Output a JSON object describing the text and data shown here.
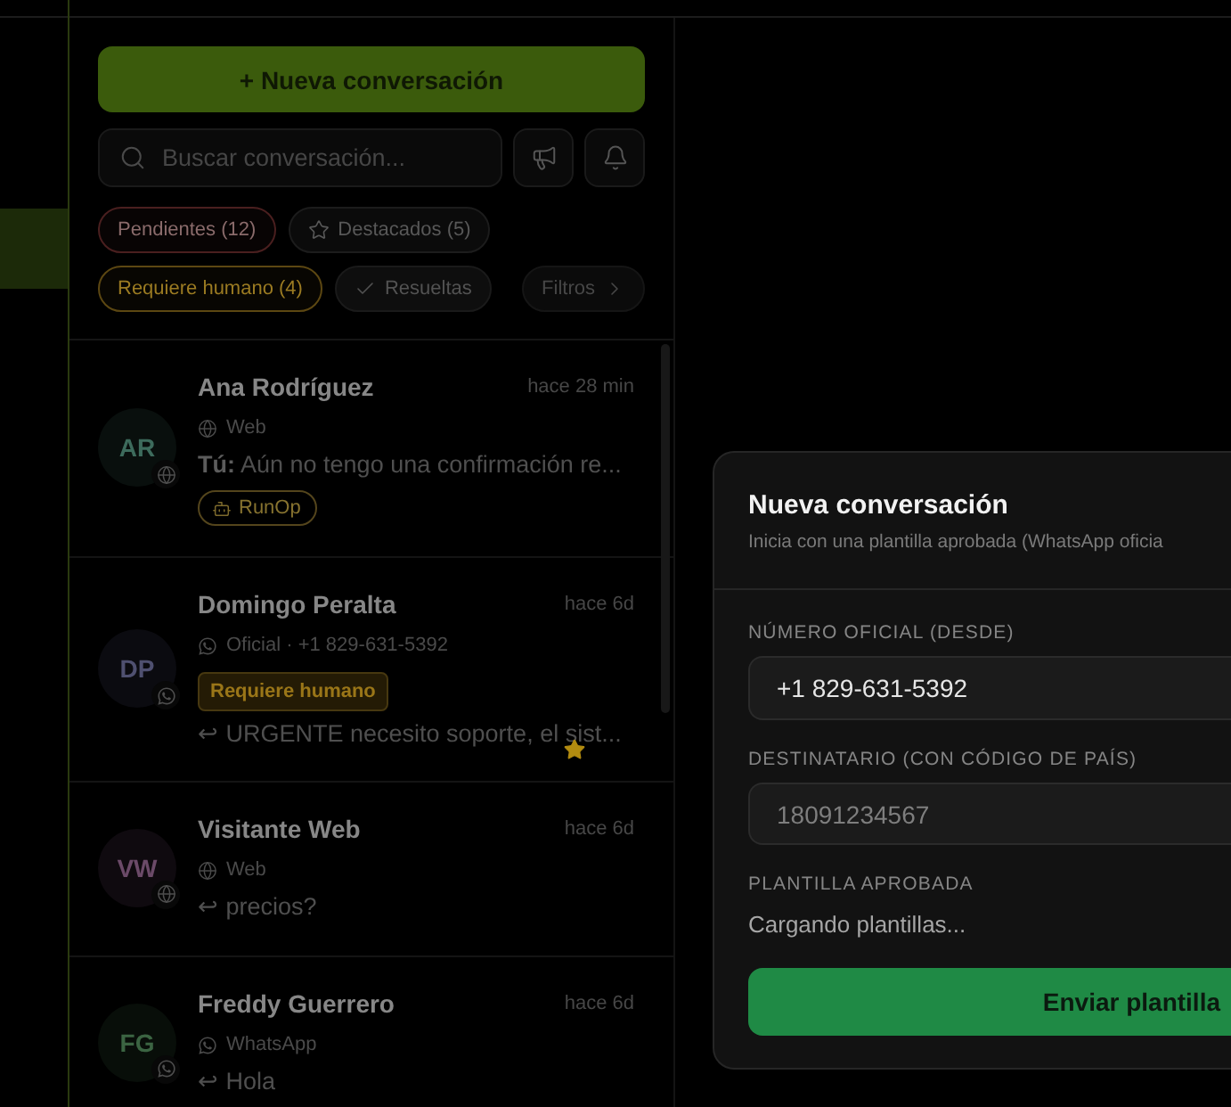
{
  "new_conversation_button": "+ Nueva conversación",
  "search": {
    "placeholder": "Buscar conversación..."
  },
  "filters": [
    {
      "kind": "pending",
      "label": "Pendientes (12)"
    },
    {
      "kind": "starred",
      "label": "Destacados (5)"
    },
    {
      "kind": "human",
      "label": "Requiere humano (4)"
    },
    {
      "kind": "resolved",
      "label": "Resueltas"
    },
    {
      "kind": "more",
      "label": "Filtros"
    }
  ],
  "conversations": [
    {
      "initials": "AR",
      "color": "#3d6b5c",
      "name": "Ana Rodríguez",
      "time": "hace 28 min",
      "channel": {
        "kind": "web",
        "label": "Web"
      },
      "preview": "**Tú:** Aún no tengo una confirmación re...",
      "tags": [
        {
          "label": "RunOp"
        }
      ],
      "starred": false
    },
    {
      "initials": "DP",
      "color": "#4f5070",
      "name": "Domingo Peralta",
      "time": "hace 6d",
      "channel": {
        "kind": "whatsapp",
        "label": "Oficial · +1 829-631-5392"
      },
      "badge": "Requiere humano",
      "preview": "↩ URGENTE necesito soporte, el sist...",
      "starred": true
    },
    {
      "initials": "VW",
      "color": "#6b4a68",
      "name": "Visitante Web",
      "time": "hace 6d",
      "channel": {
        "kind": "web",
        "label": "Web"
      },
      "preview": "↩ precios?",
      "starred": false
    },
    {
      "initials": "FG",
      "color": "#3b6442",
      "name": "Freddy Guerrero",
      "time": "hace 6d",
      "channel": {
        "kind": "whatsapp",
        "label": "WhatsApp"
      },
      "preview": "↩ Hola",
      "starred": false
    }
  ],
  "dialog": {
    "title": "Nueva conversación",
    "subtitle": "Inicia con una plantilla aprobada (WhatsApp oficia",
    "fields": [
      {
        "label": "NÚMERO OFICIAL (DESDE)",
        "value": "+1 829-631-5392"
      },
      {
        "label": "DESTINATARIO (CON CÓDIGO DE PAÍS)",
        "placeholder": "18091234567"
      }
    ],
    "template": {
      "label": "PLANTILLA APROBADA",
      "status": "Cargando plantillas..."
    },
    "submit": "Enviar plantilla"
  }
}
